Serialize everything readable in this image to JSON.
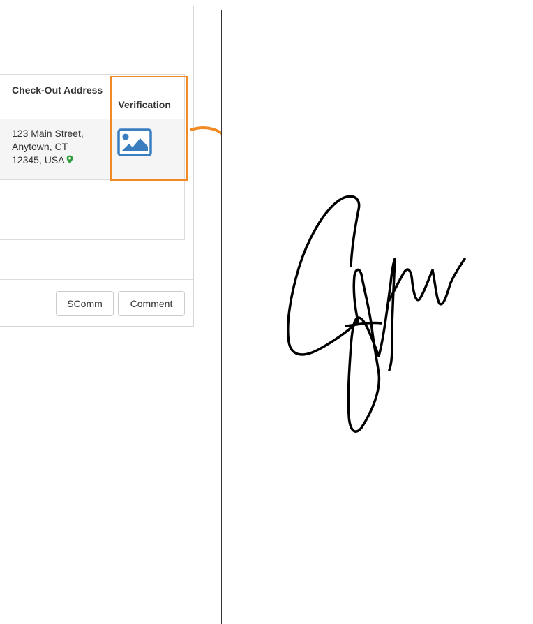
{
  "table": {
    "headers": {
      "checkout_address": "Check-Out Address",
      "verification": "Verification"
    },
    "rows": [
      {
        "address_lines": [
          "123 Main Street,",
          "Anytown, CT",
          "12345, USA"
        ],
        "verification_icon": "image-icon"
      }
    ]
  },
  "footer": {
    "scomm_label": "SComm",
    "comment_label": "Comment"
  },
  "colors": {
    "highlight": "#f08a24",
    "image_icon": "#3a7ebf",
    "map_pin": "#2e9e3c"
  },
  "signature": {
    "type": "handwritten-signature"
  }
}
